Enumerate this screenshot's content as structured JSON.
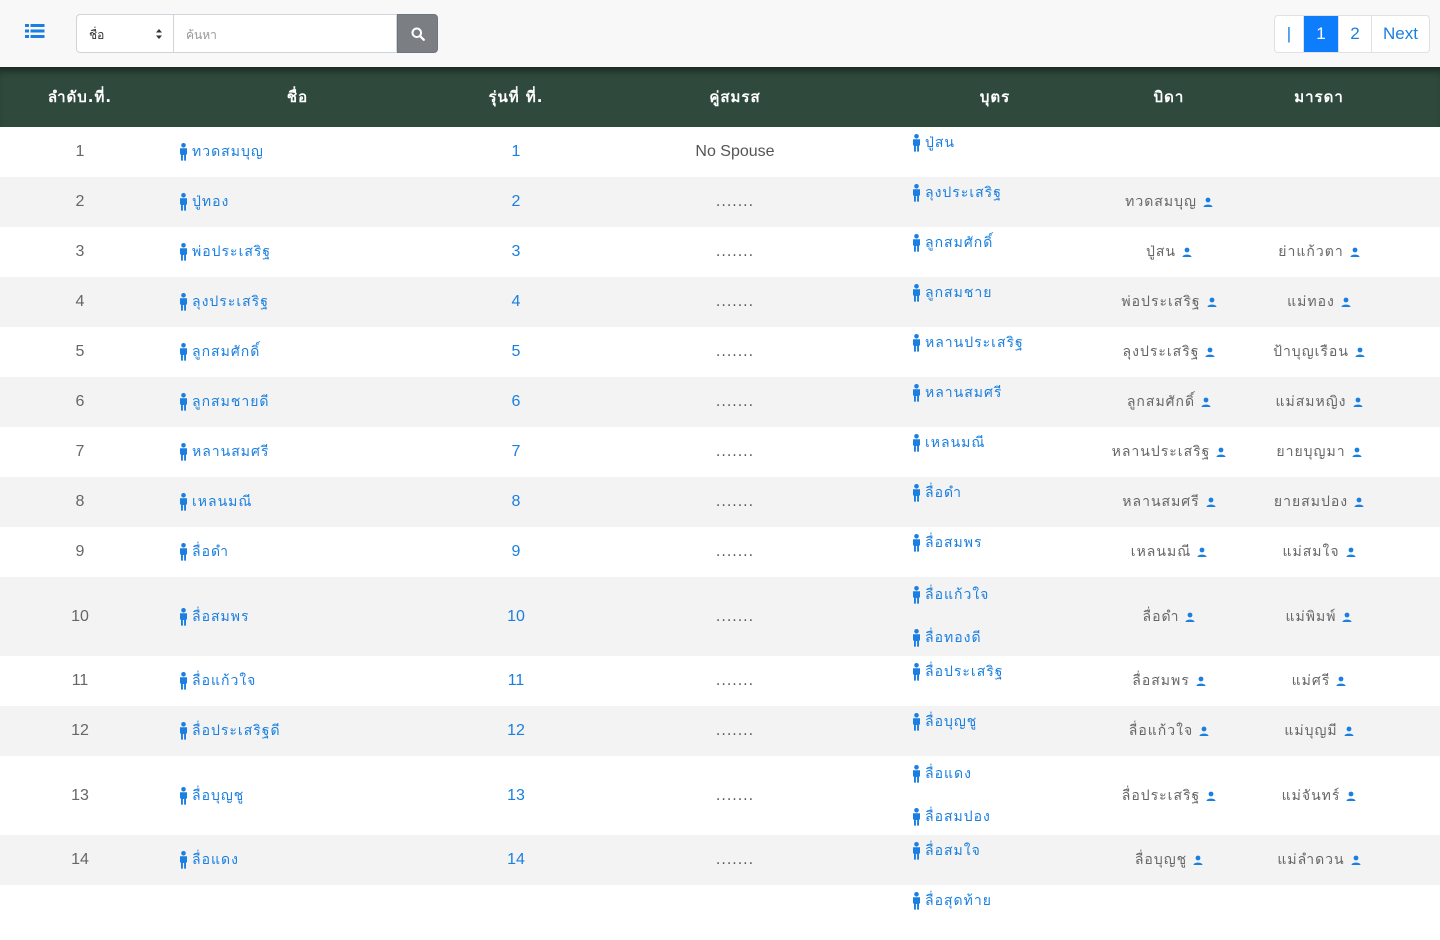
{
  "toolbar": {
    "select_value": "ชื่อ",
    "search_placeholder": "ค้นหา"
  },
  "pagination": {
    "items": [
      "|",
      "1",
      "2",
      "Next"
    ],
    "active": "1"
  },
  "colors": {
    "header_bg": "#2f4a3d",
    "link": "#1a7fe0",
    "active_page": "#0d7dfb"
  },
  "table": {
    "headers": [
      "ลำดับ.ที่.",
      "ชื่อ",
      "รุ่นที่ ที่.",
      "คู่สมรส",
      "บุตร",
      "บิดา",
      "มารดา"
    ],
    "rows": [
      {
        "no": "1",
        "name": "ทวดสมบุญ",
        "gen": "1",
        "spouse": "No Spouse",
        "children": [
          "ปู่สน"
        ],
        "father": "",
        "mother": ""
      },
      {
        "no": "2",
        "name": "ปู่ทอง",
        "gen": "2",
        "spouse": ".......",
        "children": [
          "ลุงประเสริฐ"
        ],
        "father": "ทวดสมบุญ",
        "mother": ""
      },
      {
        "no": "3",
        "name": "พ่อประเสริฐ",
        "gen": "3",
        "spouse": ".......",
        "children": [
          "ลูกสมศักดิ์"
        ],
        "father": "ปู่สน",
        "mother": "ย่าแก้วตา"
      },
      {
        "no": "4",
        "name": "ลุงประเสริฐ",
        "gen": "4",
        "spouse": ".......",
        "children": [
          "ลูกสมชาย"
        ],
        "father": "พ่อประเสริฐ",
        "mother": "แม่ทอง"
      },
      {
        "no": "5",
        "name": "ลูกสมศักดิ์",
        "gen": "5",
        "spouse": ".......",
        "children": [
          "หลานประเสริฐ"
        ],
        "father": "ลุงประเสริฐ",
        "mother": "ป้าบุญเรือน"
      },
      {
        "no": "6",
        "name": "ลูกสมชายดี",
        "gen": "6",
        "spouse": ".......",
        "children": [
          "หลานสมศรี"
        ],
        "father": "ลูกสมศักดิ์",
        "mother": "แม่สมหญิง"
      },
      {
        "no": "7",
        "name": "หลานสมศรี",
        "gen": "7",
        "spouse": ".......",
        "children": [
          "เหลนมณี"
        ],
        "father": "หลานประเสริฐ",
        "mother": "ยายบุญมา"
      },
      {
        "no": "8",
        "name": "เหลนมณี",
        "gen": "8",
        "spouse": ".......",
        "children": [
          "ลื่อดำ"
        ],
        "father": "หลานสมศรี",
        "mother": "ยายสมปอง"
      },
      {
        "no": "9",
        "name": "ลื่อดำ",
        "gen": "9",
        "spouse": ".......",
        "children": [
          "ลื่อสมพร"
        ],
        "father": "เหลนมณี",
        "mother": "แม่สมใจ"
      },
      {
        "no": "10",
        "name": "ลื่อสมพร",
        "gen": "10",
        "spouse": ".......",
        "children": [
          "ลื่อแก้วใจ",
          "ลื่อทองดี"
        ],
        "father": "ลื่อดำ",
        "mother": "แม่พิมพ์"
      },
      {
        "no": "11",
        "name": "ลื่อแก้วใจ",
        "gen": "11",
        "spouse": ".......",
        "children": [
          "ลื่อประเสริฐ"
        ],
        "father": "ลื่อสมพร",
        "mother": "แม่ศรี"
      },
      {
        "no": "12",
        "name": "ลื่อประเสริฐดี",
        "gen": "12",
        "spouse": ".......",
        "children": [
          "ลื่อบุญชู"
        ],
        "father": "ลื่อแก้วใจ",
        "mother": "แม่บุญมี"
      },
      {
        "no": "13",
        "name": "ลื่อบุญชู",
        "gen": "13",
        "spouse": ".......",
        "children": [
          "ลื่อแดง",
          "ลื่อสมปอง"
        ],
        "father": "ลื่อประเสริฐ",
        "mother": "แม่จันทร์"
      },
      {
        "no": "14",
        "name": "ลื่อแดง",
        "gen": "14",
        "spouse": ".......",
        "children": [
          "ลื่อสมใจ"
        ],
        "father": "ลื่อบุญชู",
        "mother": "แม่ลำดวน"
      },
      {
        "no": "",
        "name": "",
        "gen": "",
        "spouse": "",
        "children": [
          "ลื่อสุดท้าย"
        ],
        "father": "",
        "mother": ""
      }
    ]
  }
}
